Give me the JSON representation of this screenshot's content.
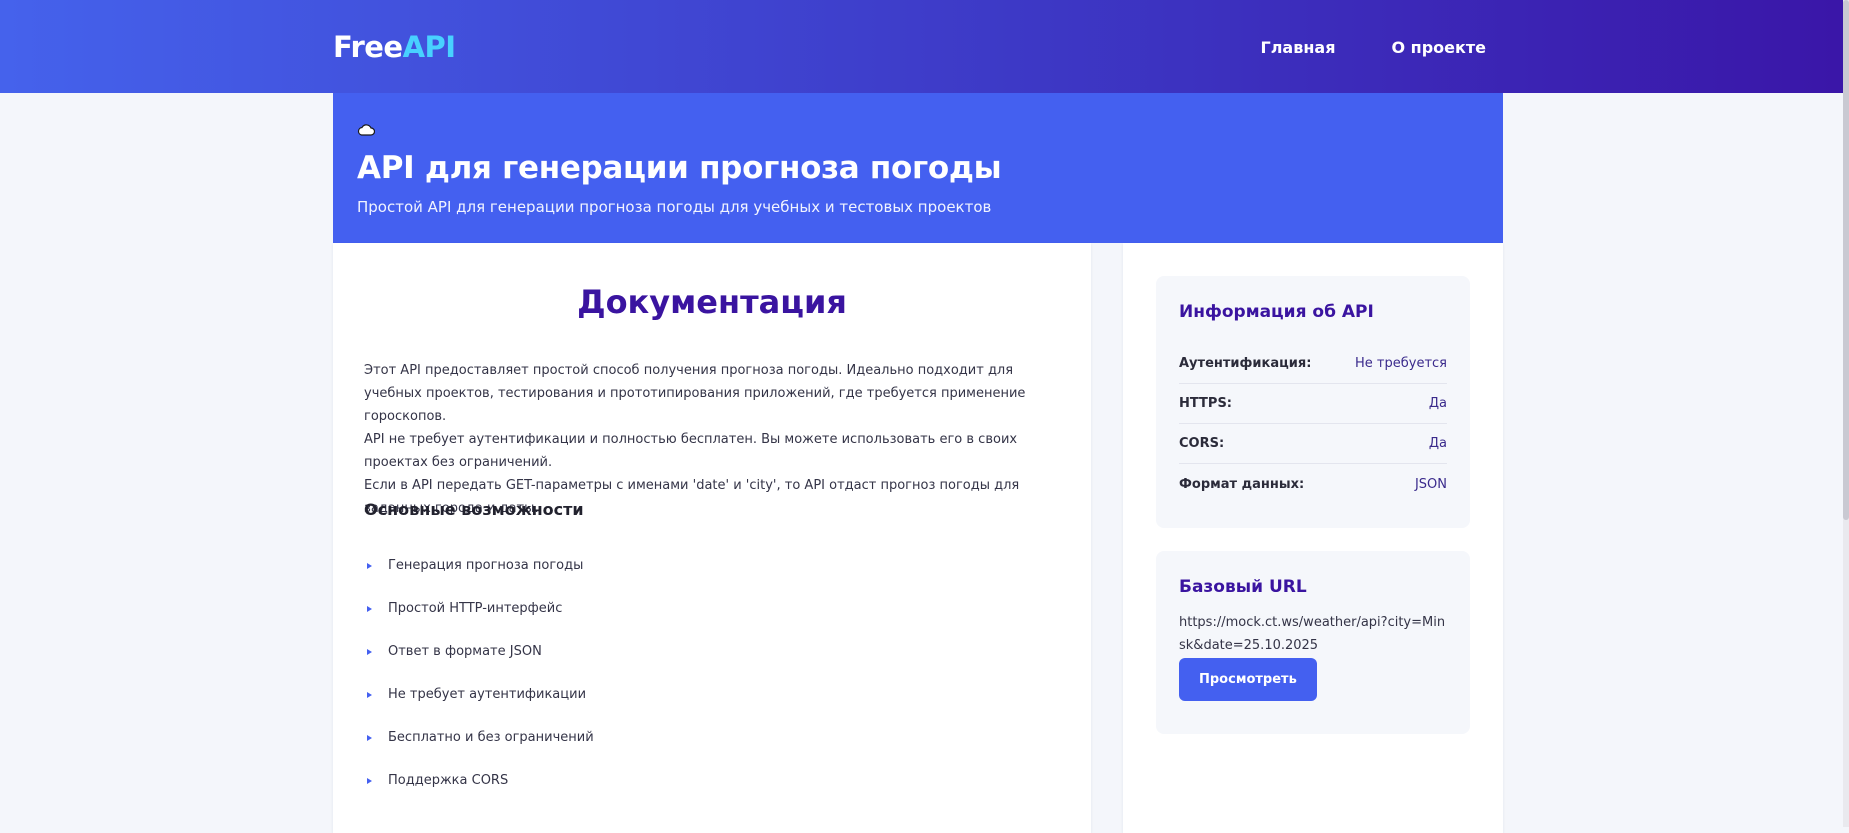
{
  "header": {
    "logo_main": "Free",
    "logo_accent": "API",
    "nav": [
      {
        "label": "Главная"
      },
      {
        "label": "О проекте"
      }
    ]
  },
  "hero": {
    "icon": "cloud-icon",
    "title": "API для генерации прогноза погоды",
    "subtitle": "Простой API для генерации прогноза погоды для учебных и тестовых проектов"
  },
  "docs": {
    "heading": "Документация",
    "paragraphs": [
      "Этот API предоставляет простой способ получения прогноза погоды. Идеально подходит для учебных проектов, тестирования и прототипирования приложений, где требуется применение гороскопов.",
      "API не требует аутентификации и полностью бесплатен. Вы можете использовать его в своих проектах без ограничений.",
      "Если в API передать GET-параметры с именами 'date' и 'city', то API отдаст прогноз погоды для заданных города и даты."
    ],
    "features_heading": "Основные возможности",
    "features": [
      "Генерация прогноза погоды",
      "Простой HTTP-интерфейс",
      "Ответ в формате JSON",
      "Не требует аутентификации",
      "Бесплатно и без ограничений",
      "Поддержка CORS"
    ]
  },
  "sidebar": {
    "info": {
      "title": "Информация об API",
      "rows": [
        {
          "label": "Аутентификация:",
          "value": "Не требуется"
        },
        {
          "label": "HTTPS:",
          "value": "Да"
        },
        {
          "label": "CORS:",
          "value": "Да"
        },
        {
          "label": "Формат данных:",
          "value": "JSON"
        }
      ]
    },
    "base_url": {
      "title": "Базовый URL",
      "url": "https://mock.ct.ws/weather/api?city=Minsk&date=25.10.2025",
      "button_label": "Просмотреть"
    }
  },
  "colors": {
    "header_gradient_start": "#4562ec",
    "header_gradient_end": "#3a16a8",
    "hero_bg": "#4460f0",
    "heading_purple": "#3a14a0",
    "logo_accent": "#48d1ff",
    "button_bg": "#4460f0"
  }
}
